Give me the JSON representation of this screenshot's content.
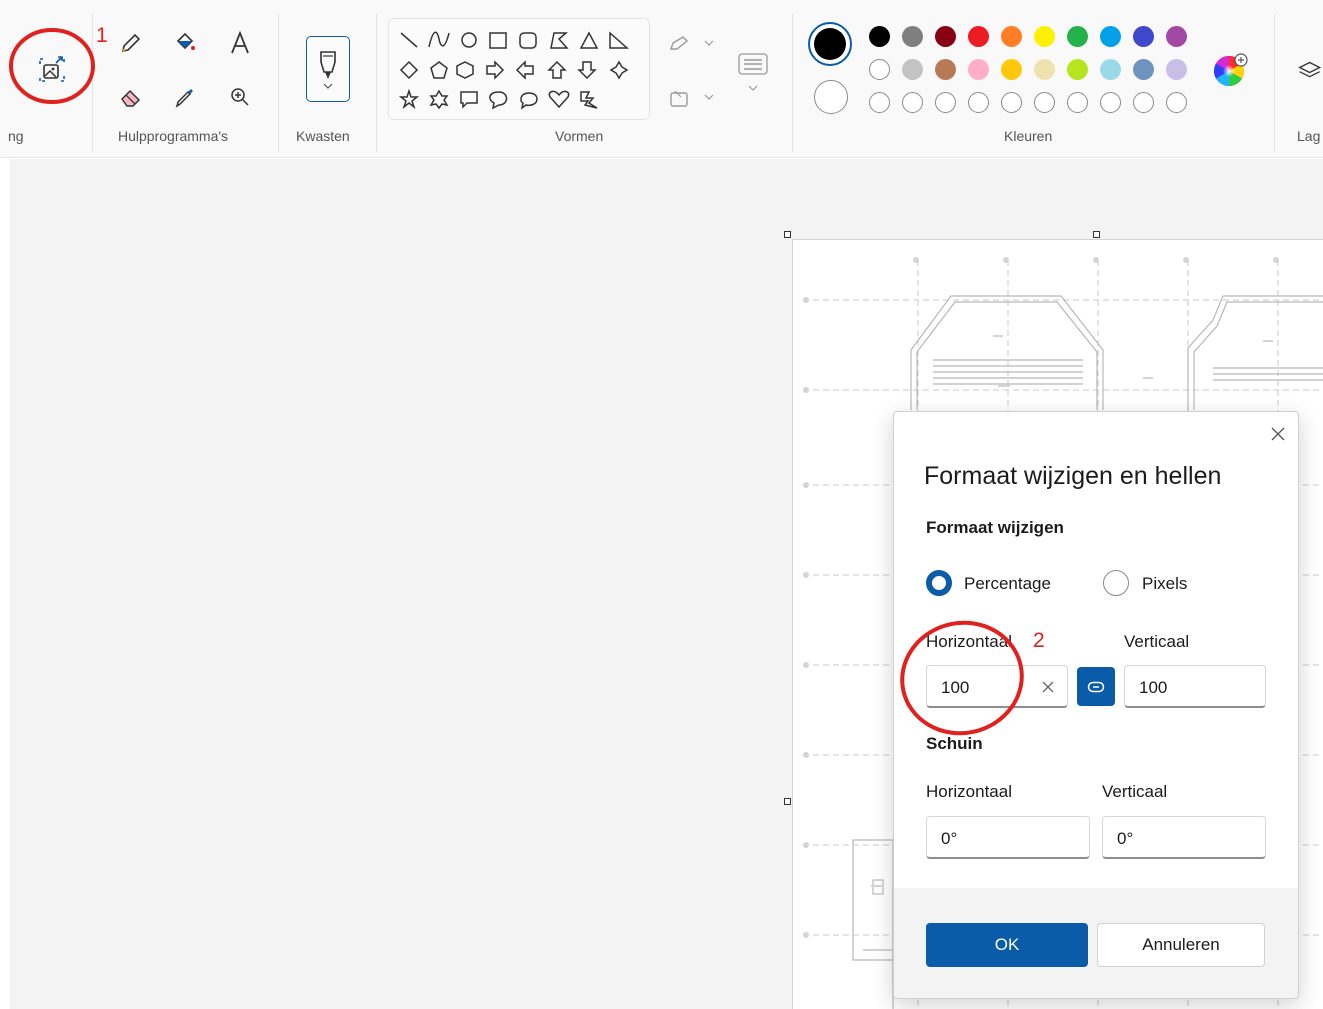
{
  "ribbon": {
    "groups": {
      "image": {
        "label_fragment": "ng"
      },
      "tools": {
        "label": "Hulpprogramma's"
      },
      "brushes": {
        "label": "Kwasten"
      },
      "shapes": {
        "label": "Vormen"
      },
      "colors": {
        "label": "Kleuren"
      },
      "layers": {
        "label_fragment": "Lag"
      }
    },
    "tools": [
      "pencil-icon",
      "fill-icon",
      "text-icon",
      "eraser-icon",
      "color-picker-icon",
      "magnifier-icon"
    ],
    "colors_row1": [
      "#000000",
      "#7f7f7f",
      "#870014",
      "#ec1c23",
      "#ff7e26",
      "#fef100",
      "#22b14b",
      "#00a1e7",
      "#3f47cc",
      "#a349a4"
    ],
    "colors_row2": [
      "#ffffff",
      "#c3c3c3",
      "#b87957",
      "#feaec9",
      "#ffc80d",
      "#eee3af",
      "#b5e61d",
      "#99d9ea",
      "#7092be",
      "#c8bfe7"
    ],
    "active_color_1": "#000000",
    "active_color_2": "#ffffff"
  },
  "annotations": {
    "marker1": "1",
    "marker2": "2",
    "color": "#e0211d"
  },
  "dialog": {
    "title": "Formaat wijzigen en hellen",
    "resize_section": "Formaat wijzigen",
    "radio_percentage": "Percentage",
    "radio_pixels": "Pixels",
    "selected_unit": "Percentage",
    "horizontal_label": "Horizontaal",
    "vertical_label": "Verticaal",
    "horizontal_value": "100",
    "vertical_value": "100",
    "skew_section": "Schuin",
    "skew_horizontal_label": "Horizontaal",
    "skew_vertical_label": "Verticaal",
    "skew_horizontal_value": "0°",
    "skew_vertical_value": "0°",
    "ok_label": "OK",
    "cancel_label": "Annuleren",
    "accent": "#0a5ba8"
  }
}
